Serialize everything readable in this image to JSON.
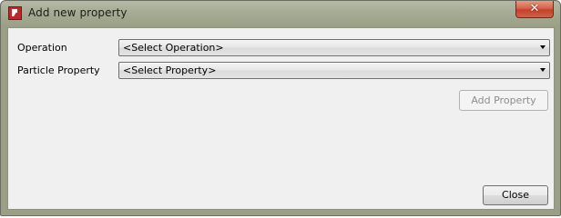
{
  "window": {
    "title": "Add new property",
    "close_glyph": "✕"
  },
  "form": {
    "operation_label": "Operation",
    "operation_value": "<Select Operation>",
    "property_label": "Particle Property",
    "property_value": "<Select Property>"
  },
  "buttons": {
    "add_property": "Add Property",
    "add_property_enabled": false,
    "close": "Close"
  },
  "colors": {
    "frame": "#9a9f86",
    "client_bg": "#f0f0f0",
    "close_button_red": "#c4412a",
    "app_icon_red": "#c0272d",
    "disabled_text": "#8d8d8d"
  },
  "icons": {
    "app": "red-app-icon",
    "window_close": "close-icon",
    "dropdown": "chevron-down-icon"
  }
}
